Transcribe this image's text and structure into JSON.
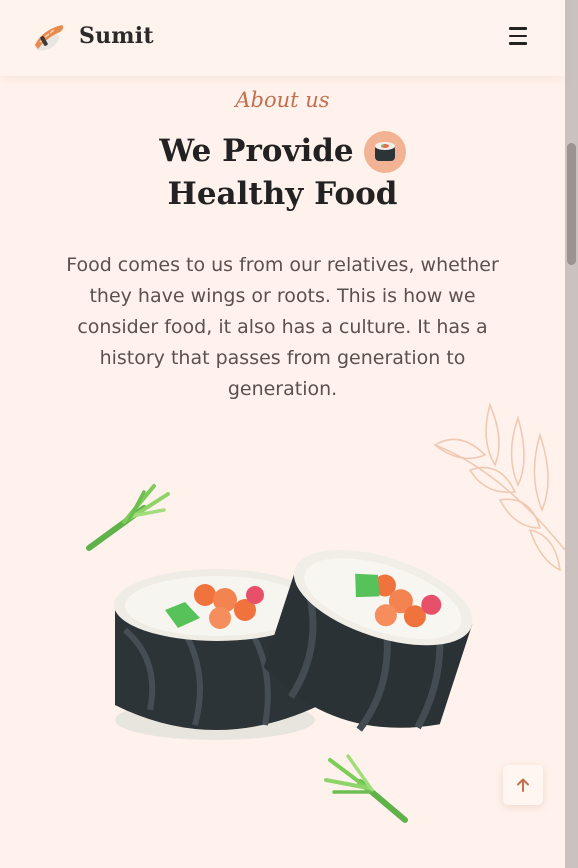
{
  "header": {
    "logo_text": "Sumit",
    "logo_icon": "nigiri-sushi-icon",
    "menu_icon": "hamburger-menu-icon"
  },
  "about": {
    "eyebrow": "About us",
    "title_line1": "We Provide",
    "title_line2": "Healthy Food",
    "title_icon": "sushi-roll-icon",
    "description": "Food comes to us from our relatives, whether they have wings or roots. This is how we consider food, it also has a culture. It has a history that passes from generation to generation."
  },
  "illustration": {
    "subject": "sushi-rolls-illustration",
    "decorations": [
      "scallion-icon",
      "leaf-branch-icon"
    ]
  },
  "back_to_top": {
    "icon": "arrow-up-icon"
  },
  "colors": {
    "background": "#fff2ec",
    "accent": "#c2714f",
    "badge": "#f1b393",
    "text": "#222222",
    "body_text": "#5a514d"
  }
}
